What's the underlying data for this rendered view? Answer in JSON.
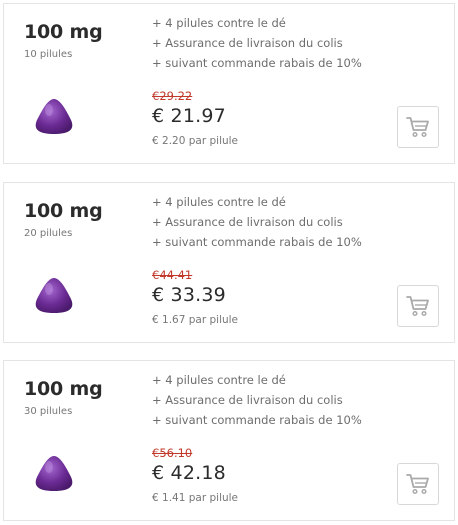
{
  "offers": [
    {
      "dose": "100 mg",
      "count": "10 pilules",
      "features": [
        "+ 4 pilules contre le dé",
        "+ Assurance de livraison du colis",
        "+ suivant commande rabais de 10%"
      ],
      "old_price": "€29.22",
      "price": "€ 21.97",
      "per_pill": "€ 2.20 par pilule"
    },
    {
      "dose": "100 mg",
      "count": "20 pilules",
      "features": [
        "+ 4 pilules contre le dé",
        "+ Assurance de livraison du colis",
        "+ suivant commande rabais de 10%"
      ],
      "old_price": "€44.41",
      "price": "€ 33.39",
      "per_pill": "€ 1.67 par pilule"
    },
    {
      "dose": "100 mg",
      "count": "30 pilules",
      "features": [
        "+ 4 pilules contre le dé",
        "+ Assurance de livraison du colis",
        "+ suivant commande rabais de 10%"
      ],
      "old_price": "€56.10",
      "price": "€ 42.18",
      "per_pill": "€ 1.41 par pilule"
    }
  ],
  "colors": {
    "pill": "#6a2a93",
    "old_price": "#c0392b",
    "cart_icon": "#aaaaaa",
    "border": "#e4e4e4"
  }
}
